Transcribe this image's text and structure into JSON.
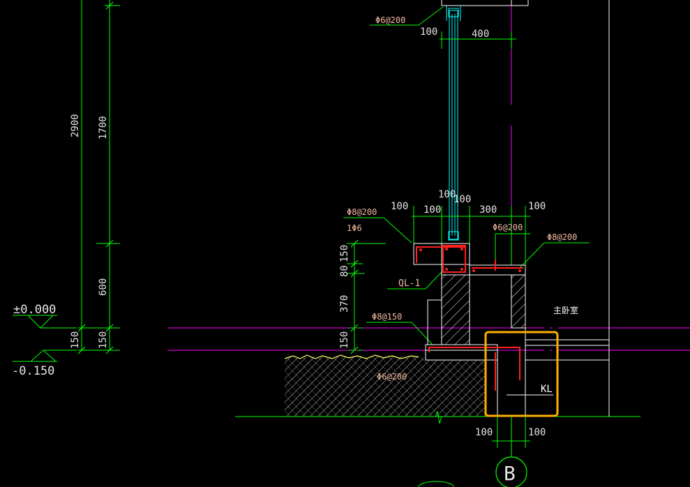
{
  "drawing": {
    "dims_vertical": {
      "d2900": "2900",
      "d1700": "1700",
      "d600": "600",
      "d150_a": "150",
      "d150_b": "150",
      "d150_c": "150",
      "d80": "80",
      "d370": "370",
      "d150_d": "150"
    },
    "dims_horizontal": {
      "d100_top": "100",
      "d400": "400",
      "d100_a": "100",
      "d100_b": "100",
      "d100_c": "100",
      "d100_d": "100",
      "d300": "300",
      "d100_e": "100",
      "d100_bottom_l": "100",
      "d100_bottom_r": "100"
    },
    "rebar_labels": {
      "phi6_200_top": "Φ6@200",
      "phi8_200_left": "Φ8@200",
      "one_phi6": "1Φ6",
      "phi6_200_mid": "Φ6@200",
      "phi8_200_right": "Φ8@200",
      "phi8_150": "Φ8@150",
      "phi6_200_bottom": "Φ6@200"
    },
    "members": {
      "ql1": "QL-1",
      "kl": "KL",
      "room": "主卧室"
    },
    "levels": {
      "zero": "±0.000",
      "minus": "-0.150"
    },
    "grid_axis": "B",
    "colors": {
      "background": "#000000",
      "dimension": "#00ff00",
      "structure": "#ffffff",
      "rebar": "#ff2020",
      "window": "#00ffff",
      "axis": "#ff00ff",
      "highlight": "#ffb000",
      "soil": "#ffff66",
      "text": "#e6e6e6",
      "label": "#f2b8a0"
    }
  }
}
